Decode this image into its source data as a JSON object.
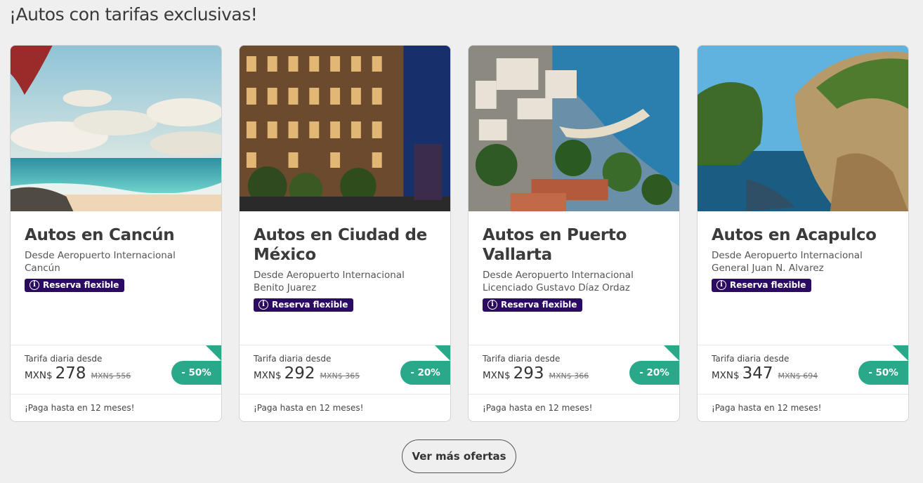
{
  "section": {
    "title": "¡Autos con tarifas exclusivas!"
  },
  "cards": [
    {
      "image": "cancun-beach-photo",
      "title": "Autos en Cancún",
      "subtitle": "Desde Aeropuerto Internacional Cancún",
      "badge": "Reserva flexible",
      "price_label": "Tarifa diaria desde",
      "currency": "MXN$",
      "price": "278",
      "old_price": "MXN$ 556",
      "discount": "- 50%",
      "note": "¡Paga hasta en 12 meses!"
    },
    {
      "image": "mexico-city-building-photo",
      "title": "Autos en Ciudad de México",
      "subtitle": "Desde Aeropuerto Internacional Benito Juarez",
      "badge": "Reserva flexible",
      "price_label": "Tarifa diaria desde",
      "currency": "MXN$",
      "price": "292",
      "old_price": "MXN$ 365",
      "discount": "- 20%",
      "note": "¡Paga hasta en 12 meses!"
    },
    {
      "image": "puerto-vallarta-coast-photo",
      "title": "Autos en Puerto Vallarta",
      "subtitle": "Desde Aeropuerto Internacional Licenciado Gustavo Díaz Ordaz",
      "badge": "Reserva flexible",
      "price_label": "Tarifa diaria desde",
      "currency": "MXN$",
      "price": "293",
      "old_price": "MXN$ 366",
      "discount": "- 20%",
      "note": "¡Paga hasta en 12 meses!"
    },
    {
      "image": "acapulco-cliffs-photo",
      "title": "Autos en Acapulco",
      "subtitle": "Desde Aeropuerto Internacional General Juan N. Alvarez",
      "badge": "Reserva flexible",
      "price_label": "Tarifa diaria desde",
      "currency": "MXN$",
      "price": "347",
      "old_price": "MXN$ 694",
      "discount": "- 50%",
      "note": "¡Paga hasta en 12 meses!"
    }
  ],
  "more_button": {
    "label": "Ver más ofertas"
  },
  "colors": {
    "badge": "#2b0a62",
    "discount": "#2aa98a",
    "background": "#efefef"
  }
}
